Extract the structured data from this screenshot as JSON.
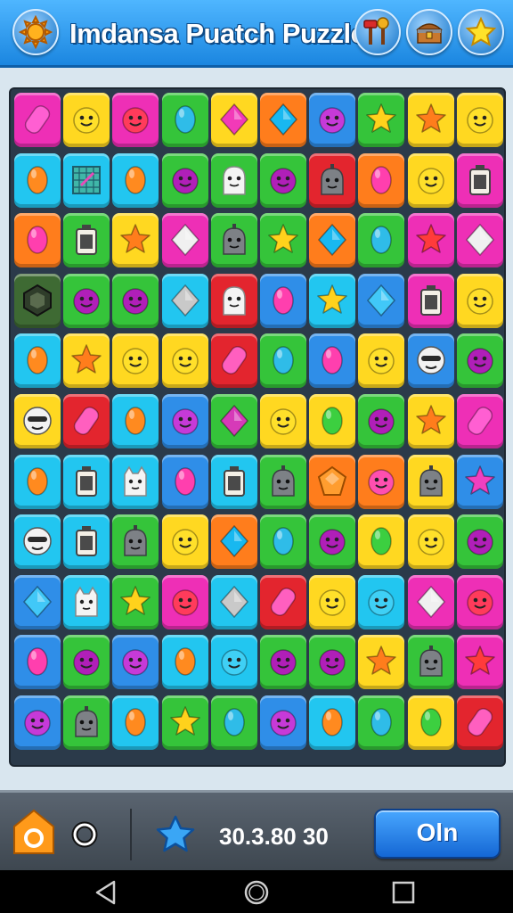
{
  "header": {
    "title": "Imdansa Puatch Puzzle",
    "left_icon": "sun-icon",
    "right_icons": [
      "hammer-tools-icon",
      "treasure-chest-icon",
      "star-badge-icon"
    ]
  },
  "board": {
    "rows": 11,
    "cols": 10,
    "tile_colors": {
      "M": "#ee2fb6",
      "Y": "#ffd821",
      "G": "#35c43a",
      "O": "#ff7d1c",
      "B": "#2f8ee8",
      "C": "#22c6f0",
      "R": "#e3252e",
      "D": "#3e6a33"
    },
    "tiles": [
      [
        "M:pill",
        "Y:face",
        "M:face",
        "G:oval",
        "Y:diamond",
        "O:diamond",
        "B:face",
        "G:star",
        "Y:star",
        "Y:face"
      ],
      [
        "C:oval",
        "C:grid",
        "C:oval",
        "G:face",
        "G:ghost",
        "G:face",
        "R:robot",
        "O:oval",
        "Y:face",
        "M:box"
      ],
      [
        "O:oval",
        "G:box",
        "Y:star",
        "M:diamond",
        "G:robot",
        "G:star",
        "O:diamond",
        "G:oval",
        "M:star",
        "M:diamond"
      ],
      [
        "D:hex",
        "G:face",
        "G:face",
        "C:diamond",
        "R:ghost",
        "B:oval",
        "C:star",
        "B:diamond",
        "M:box",
        "Y:face"
      ],
      [
        "C:oval",
        "Y:star",
        "Y:face",
        "Y:face",
        "R:pill",
        "G:oval",
        "B:oval",
        "Y:face",
        "B:mask",
        "G:face"
      ],
      [
        "Y:mask",
        "R:pill",
        "C:oval",
        "B:face",
        "G:diamond",
        "Y:face",
        "Y:oval",
        "G:face",
        "Y:star",
        "M:pill"
      ],
      [
        "C:oval",
        "C:box",
        "C:cat",
        "B:oval",
        "C:box",
        "G:robot",
        "O:pentagon",
        "O:face",
        "Y:robot",
        "B:star"
      ],
      [
        "C:mask",
        "C:box",
        "G:robot",
        "Y:face",
        "O:diamond",
        "G:oval",
        "G:face",
        "Y:oval",
        "Y:face",
        "G:face"
      ],
      [
        "B:diamond",
        "C:cat",
        "G:star",
        "M:face",
        "C:diamond",
        "R:pill",
        "Y:face",
        "C:face",
        "M:diamond",
        "M:face"
      ],
      [
        "B:oval",
        "G:face",
        "B:face",
        "C:oval",
        "C:face",
        "G:face",
        "G:face",
        "Y:star",
        "G:robot",
        "M:star"
      ],
      [
        "B:face",
        "G:robot",
        "C:oval",
        "G:star",
        "G:oval",
        "B:face",
        "C:oval",
        "G:oval",
        "Y:oval",
        "R:pill"
      ]
    ]
  },
  "bottom_bar": {
    "left_icon": "home-icon",
    "circle_icon": "circle-icon",
    "star_icon": "star-icon",
    "score": "30.3.80 30",
    "button_label": "Oln"
  },
  "nav": {
    "back_icon": "back-icon",
    "home_icon": "home-circle-icon",
    "recents_icon": "recents-icon"
  }
}
